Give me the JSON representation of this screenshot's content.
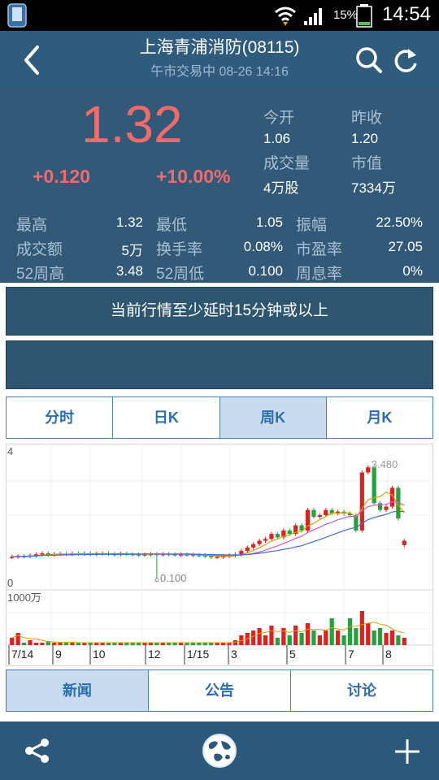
{
  "status_bar": {
    "battery": "15%",
    "time": "14:54"
  },
  "header": {
    "title": "上海青浦消防(08115)",
    "subtitle": "午市交易中  08-26  14:16"
  },
  "quote": {
    "price": "1.32",
    "change": "+0.120",
    "change_pct": "+10.00%",
    "open_label": "今开",
    "open": "1.06",
    "prev_close_label": "昨收",
    "prev_close": "1.20",
    "volume_label": "成交量",
    "volume": "4万股",
    "market_cap_label": "市值",
    "market_cap": "7334万"
  },
  "stats": [
    {
      "label": "最高",
      "value": "1.32"
    },
    {
      "label": "最低",
      "value": "1.05"
    },
    {
      "label": "振幅",
      "value": "22.50%"
    },
    {
      "label": "成交额",
      "value": "5万"
    },
    {
      "label": "换手率",
      "value": "0.08%"
    },
    {
      "label": "市盈率",
      "value": "27.05"
    },
    {
      "label": "52周高",
      "value": "3.48"
    },
    {
      "label": "52周低",
      "value": "0.100"
    },
    {
      "label": "周息率",
      "value": "0%"
    }
  ],
  "notice": "当前行情至少延时15分钟或以上",
  "chart_tabs": [
    {
      "label": "分时"
    },
    {
      "label": "日K"
    },
    {
      "label": "周K"
    },
    {
      "label": "月K"
    }
  ],
  "active_chart_tab": 2,
  "colors": {
    "up": "#e01f1f",
    "down": "#22a23a",
    "accent": "#2a6db0",
    "header": "#2f5b7d"
  },
  "chart_data": {
    "type": "candlestick",
    "price_axis": {
      "top_label": "4",
      "bottom_label": "0",
      "ylim": [
        0,
        4
      ]
    },
    "volume_axis": {
      "label": "1000万"
    },
    "max_annotation": "3.480",
    "min_annotation": "0.100",
    "x_ticks": [
      "7/14",
      "9",
      "10",
      "12",
      "1/15",
      "3",
      "5",
      "7",
      "8"
    ],
    "weekly_candles": [
      {
        "o": 0.77,
        "c": 0.78
      },
      {
        "o": 0.78,
        "c": 0.8
      },
      {
        "o": 0.8,
        "c": 0.79
      },
      {
        "o": 0.79,
        "c": 0.82
      },
      {
        "o": 0.82,
        "c": 0.85
      },
      {
        "o": 0.85,
        "c": 0.88
      },
      {
        "o": 0.88,
        "c": 0.84
      },
      {
        "o": 0.84,
        "c": 0.86
      },
      {
        "o": 0.86,
        "c": 0.87
      },
      {
        "o": 0.87,
        "c": 0.86
      },
      {
        "o": 0.86,
        "c": 0.88
      },
      {
        "o": 0.88,
        "c": 0.87
      },
      {
        "o": 0.87,
        "c": 0.88
      },
      {
        "o": 0.88,
        "c": 0.86
      },
      {
        "o": 0.86,
        "c": 0.87
      },
      {
        "o": 0.87,
        "c": 0.88
      },
      {
        "o": 0.88,
        "c": 0.86
      },
      {
        "o": 0.86,
        "c": 0.85
      },
      {
        "o": 0.85,
        "c": 0.87
      },
      {
        "o": 0.87,
        "c": 0.86
      },
      {
        "o": 0.86,
        "c": 0.85
      },
      {
        "o": 0.85,
        "c": 0.84
      },
      {
        "o": 0.84,
        "c": 0.85
      },
      {
        "o": 0.85,
        "c": 0.86
      },
      {
        "o": 0.86,
        "c": 0.85
      },
      {
        "o": 0.85,
        "c": 0.86
      },
      {
        "o": 0.86,
        "c": 0.85
      },
      {
        "o": 0.85,
        "c": 0.84
      },
      {
        "o": 0.84,
        "c": 0.85
      },
      {
        "o": 0.85,
        "c": 0.84
      },
      {
        "o": 0.84,
        "c": 0.83
      },
      {
        "o": 0.83,
        "c": 0.82
      },
      {
        "o": 0.82,
        "c": 0.8
      },
      {
        "o": 0.8,
        "c": 0.77
      },
      {
        "o": 0.77,
        "c": 0.78
      },
      {
        "o": 0.78,
        "c": 0.8
      },
      {
        "o": 0.8,
        "c": 0.82
      },
      {
        "o": 0.82,
        "c": 0.85
      },
      {
        "o": 0.85,
        "c": 0.95
      },
      {
        "o": 0.95,
        "c": 1.05
      },
      {
        "o": 1.05,
        "c": 1.15
      },
      {
        "o": 1.15,
        "c": 1.25
      },
      {
        "o": 1.25,
        "c": 1.3
      },
      {
        "o": 1.3,
        "c": 1.45
      },
      {
        "o": 1.45,
        "c": 1.35
      },
      {
        "o": 1.35,
        "c": 1.55
      },
      {
        "o": 1.55,
        "c": 1.45
      },
      {
        "o": 1.45,
        "c": 1.7
      },
      {
        "o": 1.7,
        "c": 1.55
      },
      {
        "o": 1.55,
        "c": 2.15
      },
      {
        "o": 2.15,
        "c": 1.95
      },
      {
        "o": 1.95,
        "c": 2.0
      },
      {
        "o": 2.0,
        "c": 2.15
      },
      {
        "o": 2.15,
        "c": 2.05
      },
      {
        "o": 2.05,
        "c": 2.1
      },
      {
        "o": 2.1,
        "c": 2.05
      },
      {
        "o": 2.05,
        "c": 2.0
      },
      {
        "o": 2.0,
        "c": 1.55
      },
      {
        "o": 1.55,
        "c": 3.25
      },
      {
        "o": 3.25,
        "c": 3.4
      },
      {
        "o": 3.4,
        "c": 2.35
      },
      {
        "o": 2.35,
        "c": 2.15
      },
      {
        "o": 2.15,
        "c": 2.25
      },
      {
        "o": 2.25,
        "c": 2.8
      },
      {
        "o": 2.8,
        "c": 1.9
      },
      {
        "o": 1.12,
        "c": 1.25
      }
    ],
    "weekly_volume": [
      0.15,
      0.25,
      0.05,
      0.1,
      0.05,
      0.05,
      0.08,
      0.05,
      0.05,
      0.05,
      0.05,
      0.05,
      0.05,
      0.05,
      0.05,
      0.05,
      0.05,
      0.05,
      0.05,
      0.05,
      0.05,
      0.05,
      0.05,
      0.05,
      0.05,
      0.05,
      0.05,
      0.05,
      0.05,
      0.05,
      0.05,
      0.05,
      0.05,
      0.05,
      0.05,
      0.05,
      0.05,
      0.1,
      0.2,
      0.25,
      0.3,
      0.35,
      0.2,
      0.4,
      0.15,
      0.35,
      0.2,
      0.4,
      0.25,
      0.45,
      0.3,
      0.2,
      0.3,
      0.55,
      0.3,
      0.2,
      0.55,
      0.35,
      0.7,
      0.45,
      0.3,
      0.35,
      0.25,
      0.3,
      0.2,
      0.15
    ]
  },
  "bottom_tabs": [
    {
      "label": "新闻"
    },
    {
      "label": "公告"
    },
    {
      "label": "讨论"
    }
  ],
  "active_bottom_tab": 0
}
